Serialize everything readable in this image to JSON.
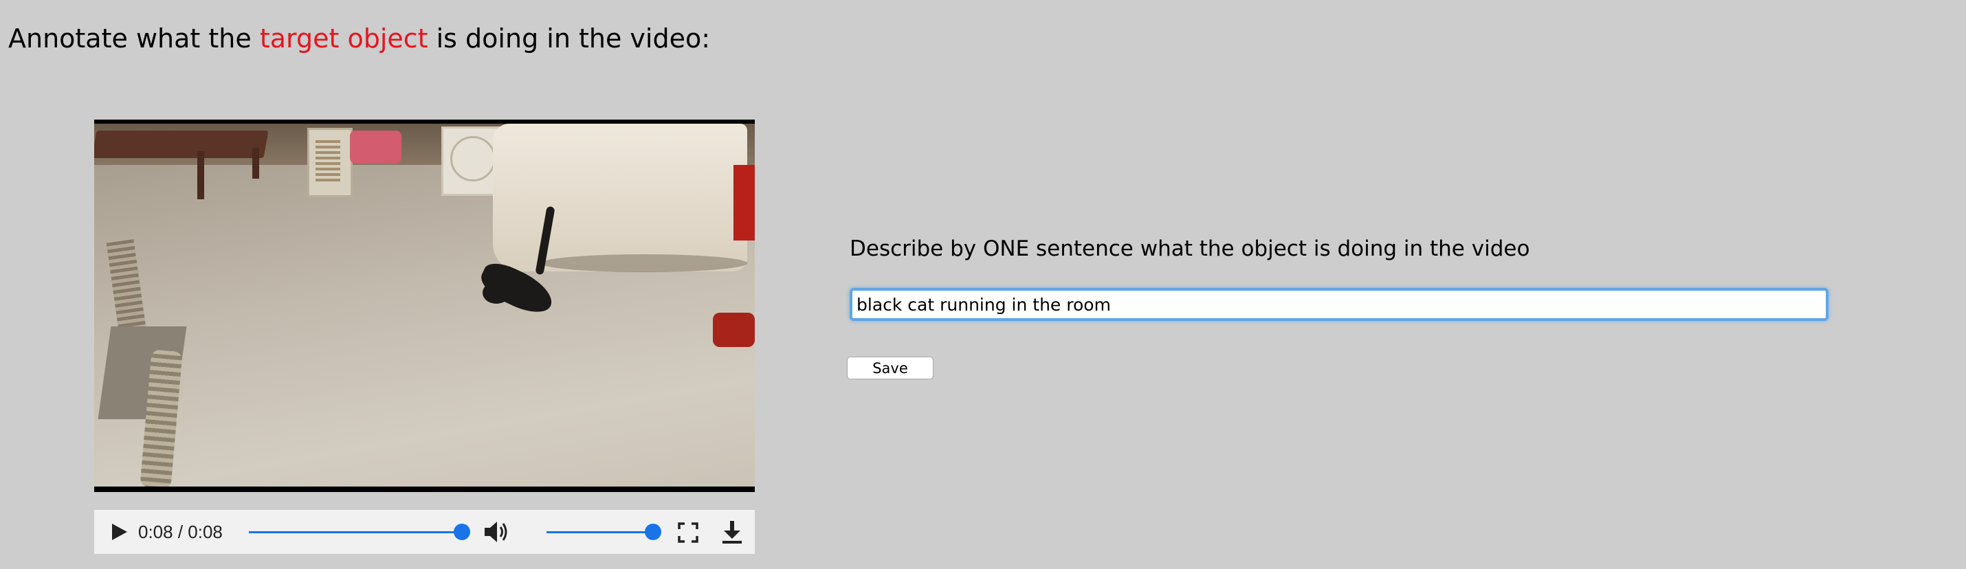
{
  "heading": {
    "prefix": "Annotate what the ",
    "highlight": "target object",
    "suffix": " is doing in the video:",
    "highlight_color": "#e8141f"
  },
  "video": {
    "time_display": "0:08 / 0:08",
    "seek_fraction": 1.0,
    "volume_fraction": 1.0,
    "icons": [
      "play-icon",
      "volume-icon",
      "fullscreen-icon",
      "download-icon"
    ],
    "accent_color": "#1a73e8"
  },
  "form": {
    "prompt": "Describe by ONE sentence what the object is doing in the video",
    "answer_value": "black cat running in the room",
    "save_label": "Save",
    "focus_color": "#5ea7e6"
  }
}
